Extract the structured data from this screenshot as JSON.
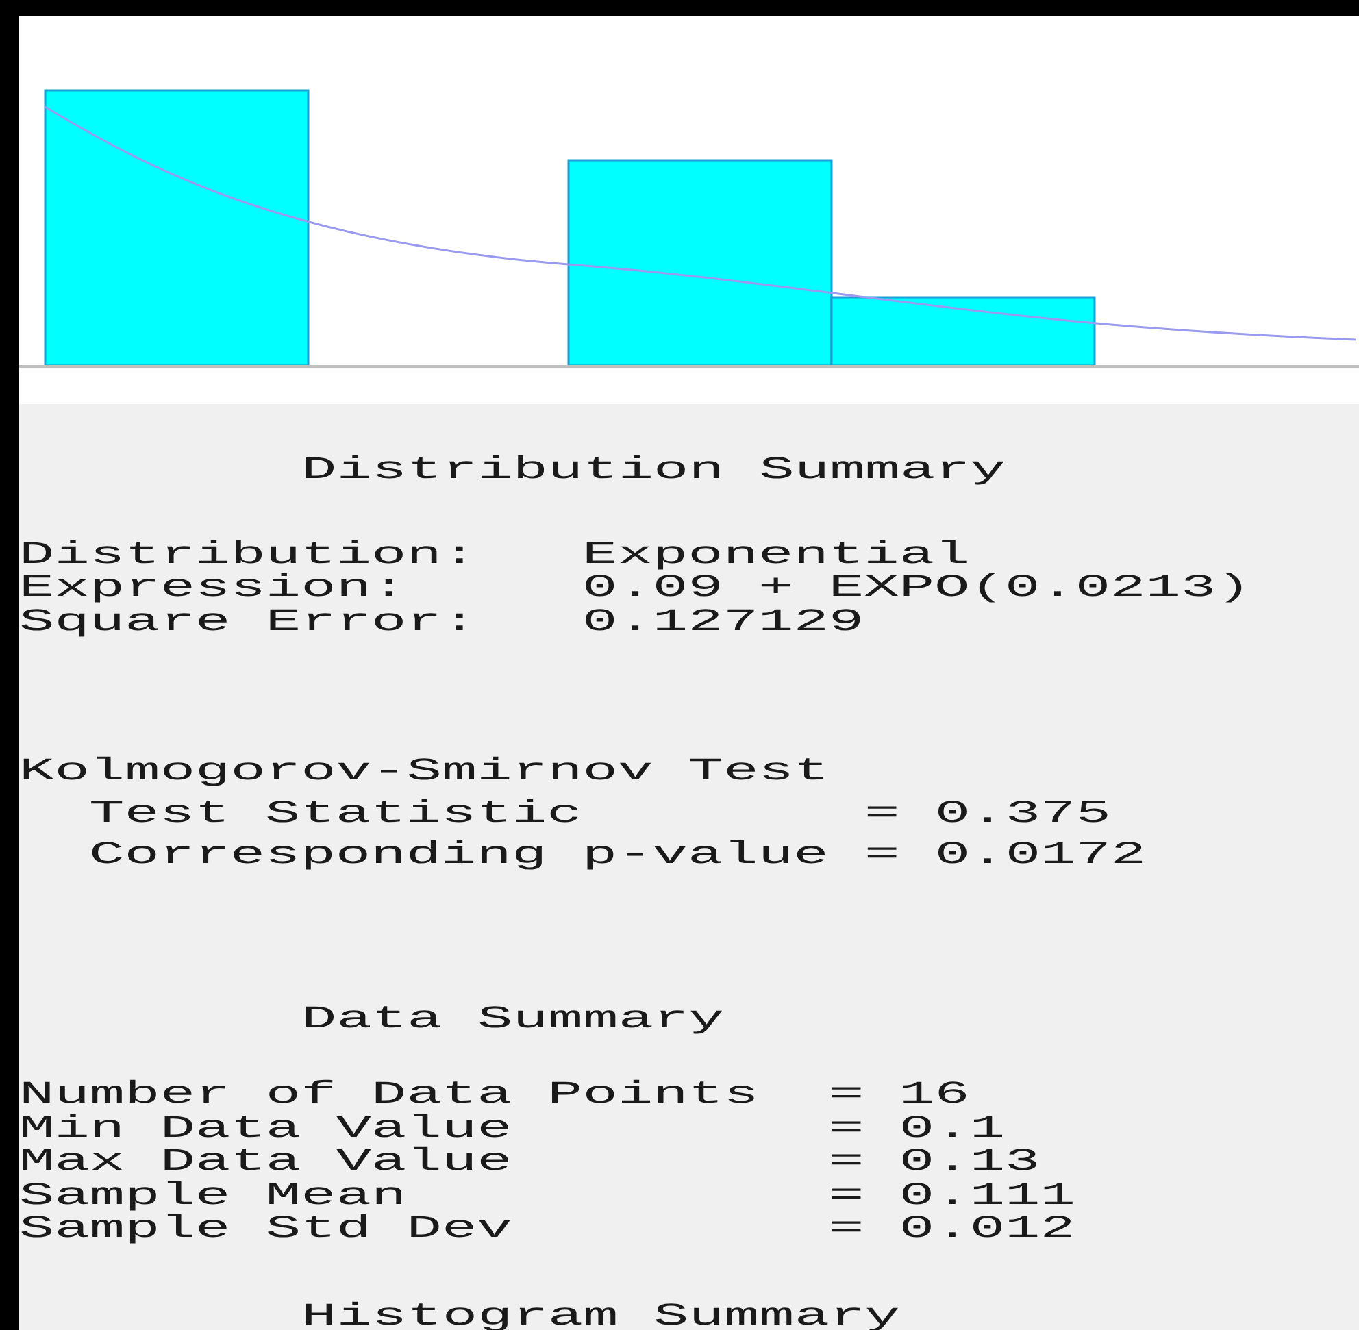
{
  "distribution_summary": {
    "title": "Distribution Summary",
    "rows": [
      {
        "label": "Distribution:",
        "value": "Exponential"
      },
      {
        "label": "Expression:",
        "value": "0.09 + EXPO(0.0213)"
      },
      {
        "label": "Square Error:",
        "value": "0.127129"
      }
    ]
  },
  "ks_test": {
    "title": "Kolmogorov-Smirnov Test",
    "rows": [
      {
        "label": "Test Statistic",
        "value": "= 0.375"
      },
      {
        "label": "Corresponding p-value",
        "value": "= 0.0172"
      }
    ]
  },
  "data_summary": {
    "title": "Data Summary",
    "rows": [
      {
        "label": "Number of Data Points",
        "value": "= 16"
      },
      {
        "label": "Min Data Value",
        "value": "= 0.1"
      },
      {
        "label": "Max Data Value",
        "value": "= 0.13"
      },
      {
        "label": "Sample Mean",
        "value": "= 0.111"
      },
      {
        "label": "Sample Std Dev",
        "value": "= 0.012"
      }
    ]
  },
  "histogram_summary": {
    "title": "Histogram Summary"
  }
}
